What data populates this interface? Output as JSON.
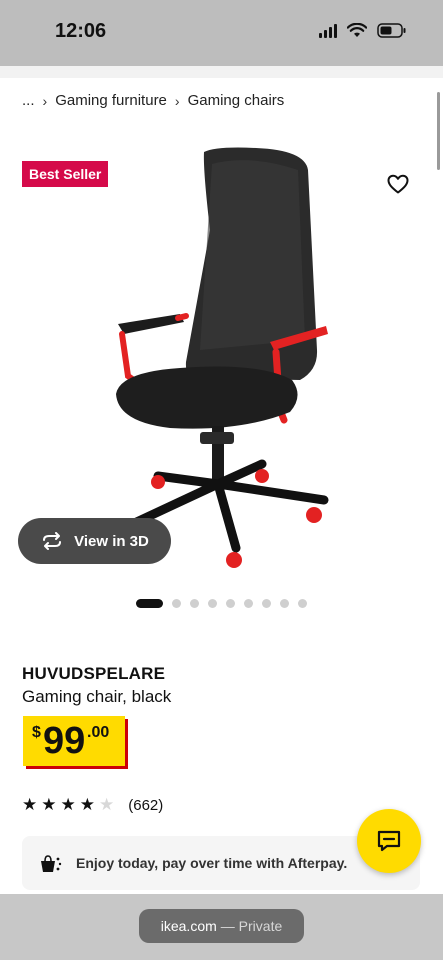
{
  "status": {
    "time": "12:06"
  },
  "breadcrumb": {
    "ellipsis": "...",
    "items": [
      "Gaming furniture",
      "Gaming chairs"
    ]
  },
  "badge": "Best Seller",
  "view3d_label": "View in 3D",
  "gallery": {
    "total_images": 9,
    "active_index": 0
  },
  "product": {
    "name": "HUVUDSPELARE",
    "description": "Gaming chair, black",
    "price": {
      "currency": "$",
      "integer": "99",
      "decimal": ".00"
    },
    "rating": {
      "stars": 4,
      "max_stars": 5,
      "reviews": "(662)"
    }
  },
  "afterpay_text": "Enjoy today, pay over time with Afterpay.",
  "browser": {
    "url": "ikea.com",
    "mode": "— Private"
  },
  "colors": {
    "brand_yellow": "#ffdb00",
    "badge_red": "#d50a4a",
    "price_shadow": "#cc0008",
    "chair_accent": "#e32222"
  },
  "icons": [
    "wishlist-heart-icon",
    "rotate-3d-icon",
    "chat-icon",
    "afterpay-icon",
    "chevron-right-icon"
  ]
}
